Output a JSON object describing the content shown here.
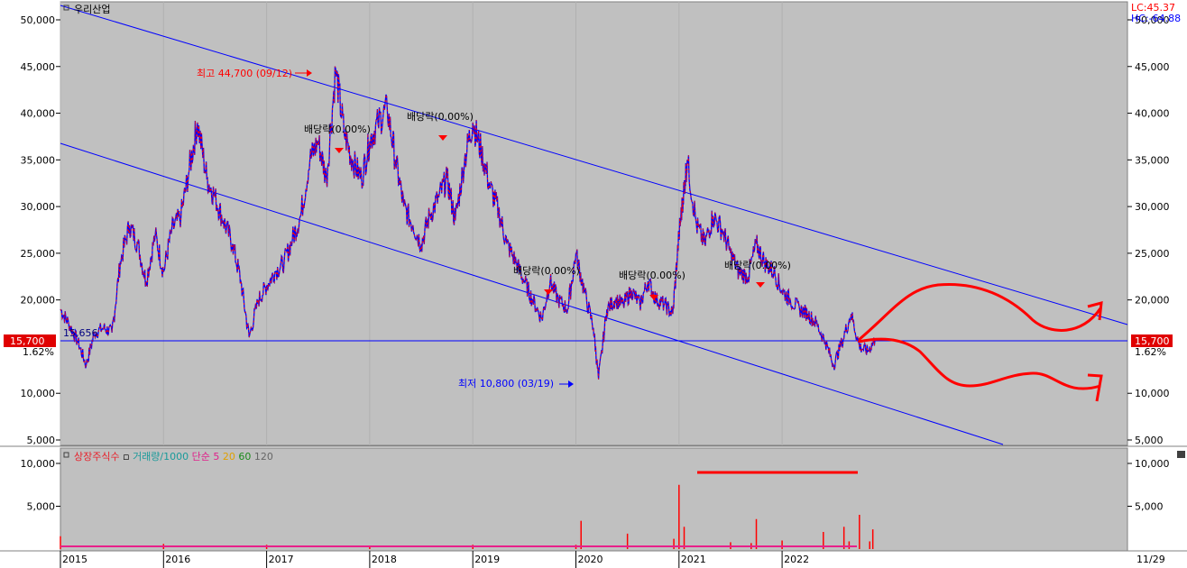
{
  "stock_name": "우리산업",
  "indicators": {
    "lc": "LC:45.37",
    "hc": "HC:-64.88"
  },
  "current_price": {
    "value": 15700,
    "label": "15,700",
    "change": "1.62%"
  },
  "left_line_value": "15,656",
  "annotations": {
    "high": "최고 44,700 (09/12)",
    "low": "최저 10,800 (03/19)",
    "dividends": [
      "배당락(0.00%)",
      "배당락(0.00%)",
      "배당락(0.00%)",
      "배당락(0.00%)",
      "배당락(0.00%)"
    ]
  },
  "volume_legend": [
    {
      "text": "상장주식수",
      "color": "#e8202a"
    },
    {
      "text": "거래량/1000",
      "color": "#1a9a9a"
    },
    {
      "text": "단순",
      "color": "#e0208a"
    },
    {
      "text": "5",
      "color": "#e0208a"
    },
    {
      "text": "20",
      "color": "#e0a000"
    },
    {
      "text": "60",
      "color": "#1a8a1a"
    },
    {
      "text": "120",
      "color": "#666666"
    }
  ],
  "date_label": "11/29",
  "colors": {
    "up": "#ff0000",
    "down": "#0000ff",
    "panel_bg": "#c0c0c0",
    "trend": "#0000ff",
    "annotation": "#ff0000"
  },
  "chart_data": {
    "type": "line",
    "price_axis": {
      "ticks": [
        "50,000",
        "45,000",
        "40,000",
        "35,000",
        "30,000",
        "25,000",
        "20,000",
        "15,700",
        "10,000",
        "5,000"
      ],
      "ylim": [
        4500,
        52500
      ]
    },
    "volume_axis": {
      "ticks": [
        "10,000",
        "5,000"
      ],
      "ylim": [
        0,
        12000
      ]
    },
    "x_labels": [
      "2015",
      "2016",
      "2017",
      "2018",
      "2019",
      "2020",
      "2021",
      "2022"
    ],
    "price_series": {
      "name": "",
      "x": [
        2015.0,
        2015.08,
        2015.17,
        2015.25,
        2015.33,
        2015.42,
        2015.5,
        2015.58,
        2015.67,
        2015.75,
        2015.83,
        2015.92,
        2016.0,
        2016.08,
        2016.17,
        2016.25,
        2016.33,
        2016.42,
        2016.5,
        2016.58,
        2016.67,
        2016.75,
        2016.83,
        2016.92,
        2017.0,
        2017.08,
        2017.17,
        2017.25,
        2017.33,
        2017.42,
        2017.5,
        2017.58,
        2017.67,
        2017.75,
        2017.83,
        2017.92,
        2018.0,
        2018.08,
        2018.17,
        2018.25,
        2018.33,
        2018.42,
        2018.5,
        2018.58,
        2018.67,
        2018.75,
        2018.83,
        2018.92,
        2019.0,
        2019.08,
        2019.17,
        2019.25,
        2019.33,
        2019.42,
        2019.5,
        2019.58,
        2019.67,
        2019.75,
        2019.83,
        2019.92,
        2020.0,
        2020.08,
        2020.17,
        2020.22,
        2020.3,
        2020.38,
        2020.46,
        2020.54,
        2020.62,
        2020.7,
        2020.78,
        2020.86,
        2020.94,
        2021.0,
        2021.04,
        2021.08,
        2021.17,
        2021.25,
        2021.33,
        2021.42,
        2021.5,
        2021.58,
        2021.67,
        2021.75,
        2021.83,
        2021.92,
        2022.0,
        2022.08,
        2022.17,
        2022.25,
        2022.33,
        2022.42,
        2022.5,
        2022.58,
        2022.67,
        2022.75,
        2022.83,
        2022.9
      ],
      "y": [
        19000,
        17500,
        15500,
        13000,
        16500,
        17000,
        16500,
        24000,
        28000,
        26000,
        22000,
        27000,
        23000,
        27500,
        29000,
        34000,
        39000,
        33000,
        31000,
        28500,
        26000,
        22000,
        16000,
        20000,
        21500,
        23000,
        24000,
        26500,
        29000,
        35000,
        37000,
        33000,
        44700,
        38000,
        35000,
        33000,
        37000,
        39000,
        40500,
        35000,
        30000,
        28000,
        26000,
        29000,
        31000,
        33000,
        28500,
        35000,
        39000,
        36000,
        32000,
        29500,
        26000,
        24000,
        22000,
        20000,
        18000,
        22000,
        20000,
        19000,
        25000,
        21000,
        17000,
        11500,
        19000,
        20000,
        19500,
        21000,
        19500,
        22000,
        20000,
        19500,
        18500,
        27000,
        31000,
        35000,
        28000,
        26000,
        29000,
        27500,
        25000,
        23000,
        22500,
        26000,
        24000,
        23000,
        21000,
        20000,
        19000,
        18500,
        17500,
        15500,
        13000,
        15500,
        18500,
        15000,
        14500,
        15700
      ]
    },
    "volume_series": {
      "name": "",
      "x": [
        2015.0,
        2016.0,
        2017.0,
        2018.0,
        2019.0,
        2020.0,
        2020.05,
        2020.5,
        2020.95,
        2021.0,
        2021.05,
        2021.5,
        2021.7,
        2021.75,
        2022.0,
        2022.4,
        2022.6,
        2022.65,
        2022.75,
        2022.85,
        2022.88
      ],
      "y": [
        1500,
        600,
        500,
        400,
        500,
        500,
        3300,
        1800,
        1200,
        7500,
        2600,
        800,
        700,
        3500,
        1000,
        2000,
        2600,
        900,
        4000,
        900,
        2300
      ]
    }
  }
}
